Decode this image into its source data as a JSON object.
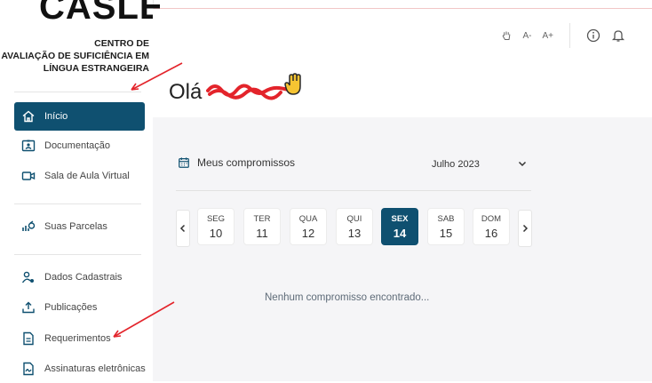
{
  "logo": {
    "big": "CASLE",
    "lines": [
      "CENTRO DE",
      "AVALIAÇÃO DE SUFICIÊNCIA EM",
      "LÍNGUA ESTRANGEIRA"
    ]
  },
  "sidebar": {
    "items": [
      {
        "label": "Início",
        "icon": "home-icon"
      },
      {
        "label": "Documentação",
        "icon": "id-card-icon"
      },
      {
        "label": "Sala de Aula Virtual",
        "icon": "video-icon"
      },
      {
        "label": "Suas Parcelas",
        "icon": "money-icon"
      },
      {
        "label": "Dados Cadastrais",
        "icon": "user-gear-icon"
      },
      {
        "label": "Publicações",
        "icon": "upload-icon"
      },
      {
        "label": "Requerimentos",
        "icon": "document-icon"
      },
      {
        "label": "Assinaturas eletrônicas",
        "icon": "signature-icon"
      }
    ]
  },
  "header": {
    "greeting": "Olá",
    "controls": {
      "font_decrease": "A-",
      "font_increase": "A+"
    }
  },
  "main": {
    "section_title": "Meus compromissos",
    "month": "Julho 2023",
    "days": [
      {
        "weekday": "SEG",
        "num": "10"
      },
      {
        "weekday": "TER",
        "num": "11"
      },
      {
        "weekday": "QUA",
        "num": "12"
      },
      {
        "weekday": "QUI",
        "num": "13"
      },
      {
        "weekday": "SEX",
        "num": "14"
      },
      {
        "weekday": "SAB",
        "num": "15"
      },
      {
        "weekday": "DOM",
        "num": "16"
      }
    ],
    "selected_day_index": 4,
    "empty_message": "Nenhum compromisso encontrado..."
  },
  "colors": {
    "primary": "#0f5070",
    "annotation": "#e3242b",
    "background": "#f5f5f7"
  }
}
